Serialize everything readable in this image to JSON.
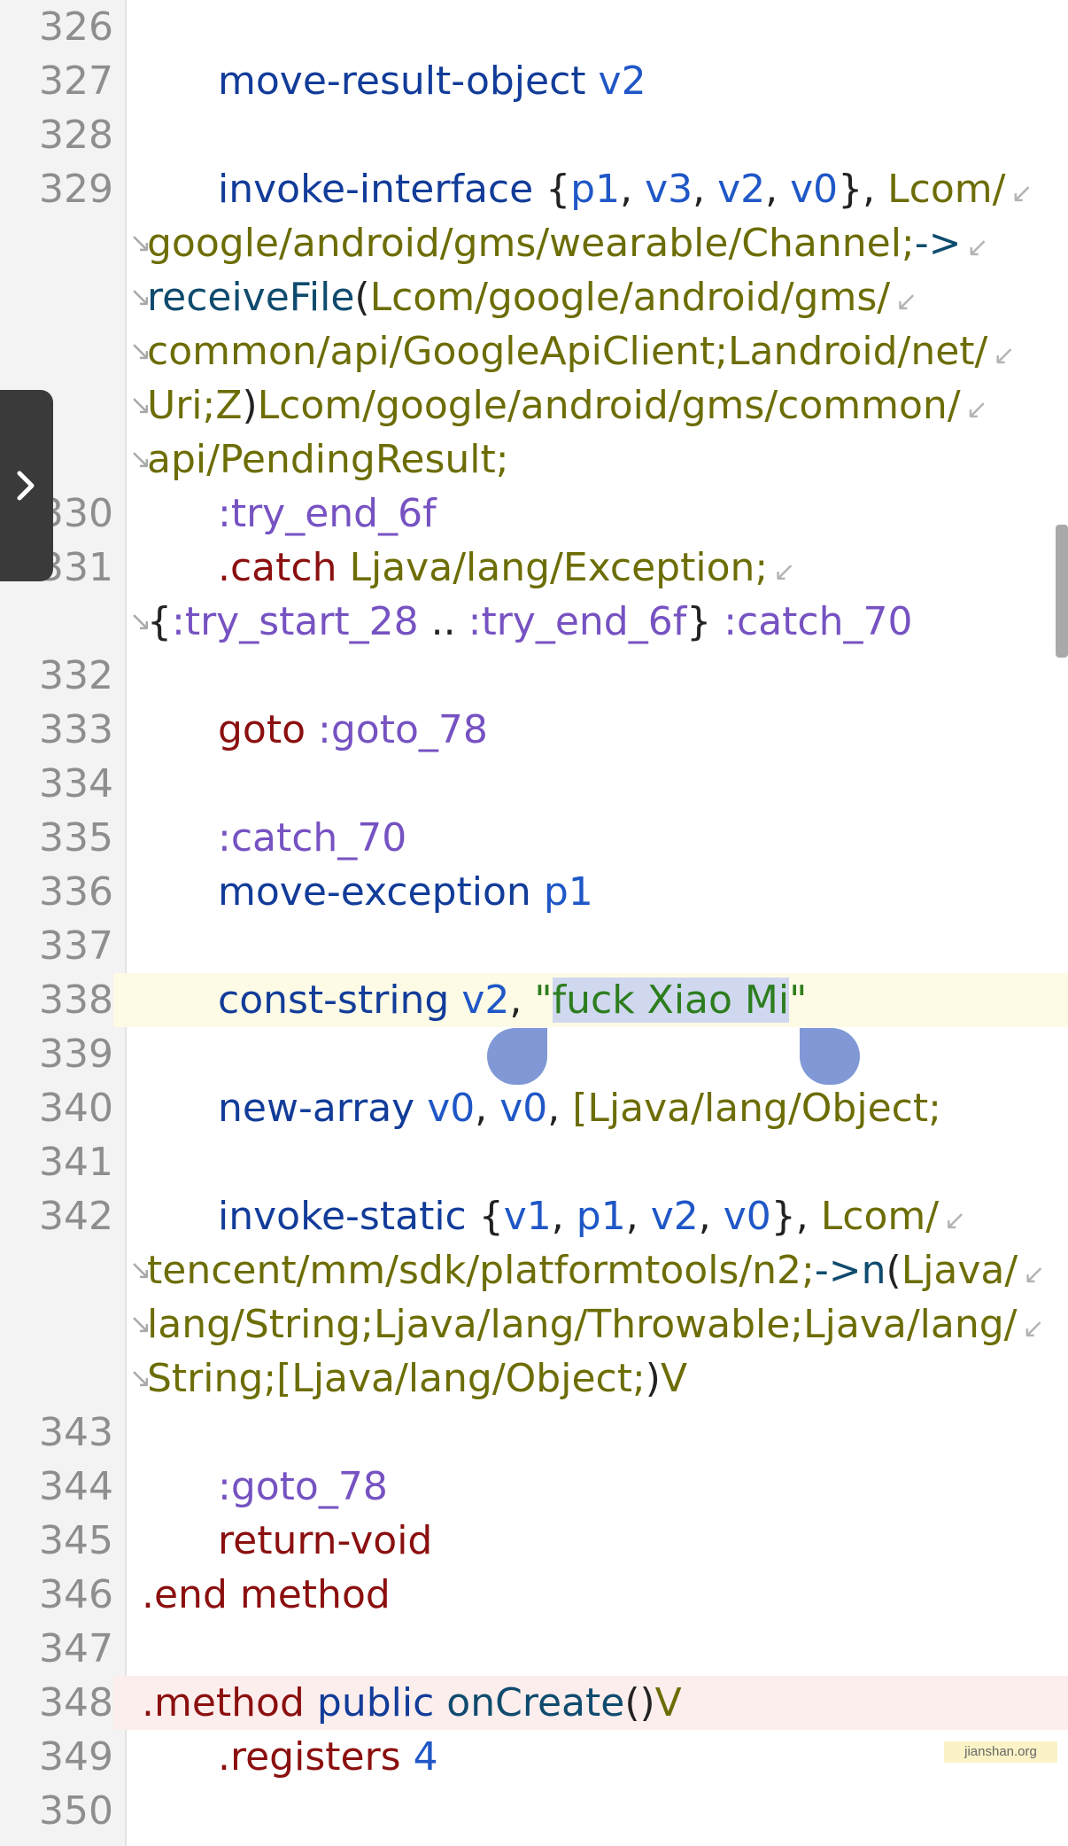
{
  "editor": {
    "lines": [
      {
        "number": "326",
        "tokens": []
      },
      {
        "number": "327",
        "tokens": [
          {
            "t": "move-result-object",
            "c": "op"
          },
          {
            "t": " ",
            "c": "punc"
          },
          {
            "t": "v2",
            "c": "reg"
          }
        ]
      },
      {
        "number": "328",
        "tokens": []
      },
      {
        "number": "329",
        "tokens": [
          {
            "t": "invoke-interface",
            "c": "op"
          },
          {
            "t": " {",
            "c": "punc"
          },
          {
            "t": "p1",
            "c": "reg"
          },
          {
            "t": ", ",
            "c": "punc"
          },
          {
            "t": "v3",
            "c": "reg"
          },
          {
            "t": ", ",
            "c": "punc"
          },
          {
            "t": "v2",
            "c": "reg"
          },
          {
            "t": ", ",
            "c": "punc"
          },
          {
            "t": "v0",
            "c": "reg"
          },
          {
            "t": "}, ",
            "c": "punc"
          },
          {
            "t": "Lcom/",
            "c": "type"
          }
        ]
      },
      {
        "number": "",
        "tokens": [
          {
            "t": "google/android/gms/wearable/Channel;",
            "c": "type"
          },
          {
            "t": "->",
            "c": "method"
          }
        ]
      },
      {
        "number": "",
        "tokens": [
          {
            "t": "receiveFile",
            "c": "method"
          },
          {
            "t": "(",
            "c": "punc"
          },
          {
            "t": "Lcom/google/android/gms/",
            "c": "type"
          }
        ]
      },
      {
        "number": "",
        "tokens": [
          {
            "t": "common/api/GoogleApiClient;Landroid/net/",
            "c": "type"
          }
        ]
      },
      {
        "number": "",
        "tokens": [
          {
            "t": "Uri;Z",
            "c": "type"
          },
          {
            "t": ")",
            "c": "punc"
          },
          {
            "t": "Lcom/google/android/gms/common/",
            "c": "type"
          }
        ]
      },
      {
        "number": "",
        "tokens": [
          {
            "t": "api/PendingResult;",
            "c": "type"
          }
        ]
      },
      {
        "number": "330",
        "tokens": [
          {
            "t": ":try_end_6f",
            "c": "label"
          }
        ]
      },
      {
        "number": "331",
        "tokens": [
          {
            "t": ".catch",
            "c": "kw"
          },
          {
            "t": " ",
            "c": "punc"
          },
          {
            "t": "Ljava/lang/Exception;",
            "c": "type"
          }
        ]
      },
      {
        "number": "",
        "tokens": [
          {
            "t": "{",
            "c": "punc"
          },
          {
            "t": ":try_start_28",
            "c": "label"
          },
          {
            "t": " .. ",
            "c": "punc"
          },
          {
            "t": ":try_end_6f",
            "c": "label"
          },
          {
            "t": "} ",
            "c": "punc"
          },
          {
            "t": ":catch_70",
            "c": "label"
          }
        ]
      },
      {
        "number": "332",
        "tokens": []
      },
      {
        "number": "333",
        "tokens": [
          {
            "t": "goto",
            "c": "kw"
          },
          {
            "t": " ",
            "c": "punc"
          },
          {
            "t": ":goto_78",
            "c": "label"
          }
        ]
      },
      {
        "number": "334",
        "tokens": []
      },
      {
        "number": "335",
        "tokens": [
          {
            "t": ":catch_70",
            "c": "label"
          }
        ]
      },
      {
        "number": "336",
        "tokens": [
          {
            "t": "move-exception",
            "c": "op"
          },
          {
            "t": " ",
            "c": "punc"
          },
          {
            "t": "p1",
            "c": "reg"
          }
        ]
      },
      {
        "number": "337",
        "tokens": []
      },
      {
        "number": "338",
        "tokens": [
          {
            "t": "const-string",
            "c": "op"
          },
          {
            "t": " ",
            "c": "punc"
          },
          {
            "t": "v2",
            "c": "reg"
          },
          {
            "t": ", ",
            "c": "punc"
          },
          {
            "t": "\"",
            "c": "str"
          },
          {
            "t": "fuck Xiao Mi",
            "c": "str",
            "sel": true
          },
          {
            "t": "\"",
            "c": "str"
          }
        ]
      },
      {
        "number": "339",
        "tokens": []
      },
      {
        "number": "340",
        "tokens": [
          {
            "t": "new-array",
            "c": "op"
          },
          {
            "t": " ",
            "c": "punc"
          },
          {
            "t": "v0",
            "c": "reg"
          },
          {
            "t": ", ",
            "c": "punc"
          },
          {
            "t": "v0",
            "c": "reg"
          },
          {
            "t": ", ",
            "c": "punc"
          },
          {
            "t": "[Ljava/lang/Object;",
            "c": "type"
          }
        ]
      },
      {
        "number": "341",
        "tokens": []
      },
      {
        "number": "342",
        "tokens": [
          {
            "t": "invoke-static",
            "c": "op"
          },
          {
            "t": " {",
            "c": "punc"
          },
          {
            "t": "v1",
            "c": "reg"
          },
          {
            "t": ", ",
            "c": "punc"
          },
          {
            "t": "p1",
            "c": "reg"
          },
          {
            "t": ", ",
            "c": "punc"
          },
          {
            "t": "v2",
            "c": "reg"
          },
          {
            "t": ", ",
            "c": "punc"
          },
          {
            "t": "v0",
            "c": "reg"
          },
          {
            "t": "}, ",
            "c": "punc"
          },
          {
            "t": "Lcom/",
            "c": "type"
          }
        ]
      },
      {
        "number": "",
        "tokens": [
          {
            "t": "tencent/mm/sdk/platformtools/n2;",
            "c": "type"
          },
          {
            "t": "->",
            "c": "method"
          },
          {
            "t": "n",
            "c": "method"
          },
          {
            "t": "(",
            "c": "punc"
          },
          {
            "t": "Ljava/",
            "c": "type"
          }
        ]
      },
      {
        "number": "",
        "tokens": [
          {
            "t": "lang/String;Ljava/lang/Throwable;Ljava/lang/",
            "c": "type"
          }
        ]
      },
      {
        "number": "",
        "tokens": [
          {
            "t": "String;[Ljava/lang/Object;",
            "c": "type"
          },
          {
            "t": ")",
            "c": "punc"
          },
          {
            "t": "V",
            "c": "type"
          }
        ]
      },
      {
        "number": "343",
        "tokens": []
      },
      {
        "number": "344",
        "tokens": [
          {
            "t": ":goto_78",
            "c": "label"
          }
        ]
      },
      {
        "number": "345",
        "tokens": [
          {
            "t": "return-void",
            "c": "kw"
          }
        ]
      },
      {
        "number": "346",
        "tokens": [
          {
            "t": ".end",
            "c": "kw"
          },
          {
            "t": " ",
            "c": "punc"
          },
          {
            "t": "method",
            "c": "kw"
          }
        ]
      },
      {
        "number": "347",
        "tokens": []
      },
      {
        "number": "348",
        "tokens": [
          {
            "t": ".method",
            "c": "kw"
          },
          {
            "t": " ",
            "c": "punc"
          },
          {
            "t": "public",
            "c": "op"
          },
          {
            "t": " ",
            "c": "punc"
          },
          {
            "t": "onCreate",
            "c": "method"
          },
          {
            "t": "()",
            "c": "punc"
          },
          {
            "t": "V",
            "c": "type"
          }
        ]
      },
      {
        "number": "349",
        "tokens": [
          {
            "t": ".registers",
            "c": "kw"
          },
          {
            "t": " ",
            "c": "punc"
          },
          {
            "t": "4",
            "c": "num"
          }
        ]
      },
      {
        "number": "350",
        "tokens": []
      }
    ]
  },
  "highlights": {
    "current_line": "338",
    "marked_line": "348"
  },
  "side_panel": {
    "icon": "chevron-right-icon"
  },
  "watermark": {
    "text": "jianshan.org"
  },
  "colors": {
    "opcode": "#123c99",
    "register": "#1f57c7",
    "type": "#6d6d06",
    "method": "#0f4b6e",
    "label": "#7652c2",
    "keyword": "#8b0f0f",
    "string": "#2d7d1e",
    "selection": "#cfd8ee",
    "selection_handle": "#8098d6",
    "current_line_bg": "#fdfbe5",
    "marked_line_bg": "#fdeeee"
  }
}
